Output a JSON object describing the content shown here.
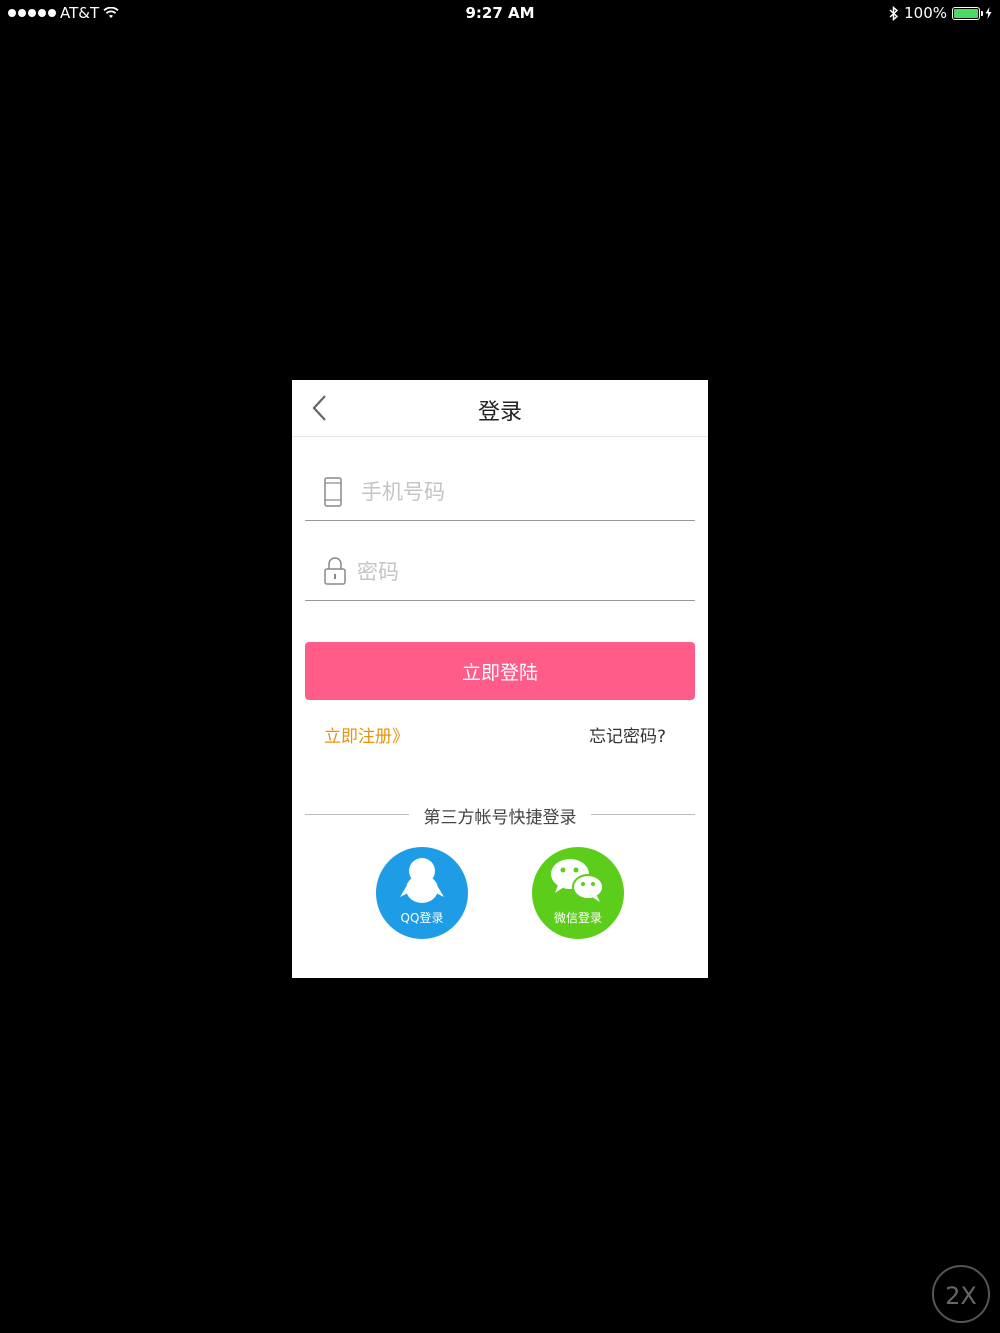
{
  "status_bar": {
    "carrier": "AT&T",
    "time": "9:27 AM",
    "battery": "100%",
    "battery_level": 1.0,
    "icons": [
      "signal-dots-icon",
      "wifi-icon",
      "bluetooth-icon",
      "battery-icon",
      "charging-bolt-icon"
    ]
  },
  "nav": {
    "title": "登录",
    "back_icon": "chevron-left-icon"
  },
  "form": {
    "phone_placeholder": "手机号码",
    "phone_value": "",
    "phone_icon": "phone-icon",
    "password_placeholder": "密码",
    "password_value": "",
    "password_icon": "lock-icon",
    "login_button": "立即登陆",
    "register_link": "立即注册》",
    "forgot_link": "忘记密码?"
  },
  "third_party": {
    "divider_text": "第三方帐号快捷登录",
    "qq_label": "QQ登录",
    "wechat_label": "微信登录"
  },
  "zoom_badge": "2X",
  "colors": {
    "accent": "#ff5c8a",
    "register_link": "#e8920e",
    "qq": "#1e9ce6",
    "wechat": "#5ccd1b",
    "background": "#000000"
  }
}
